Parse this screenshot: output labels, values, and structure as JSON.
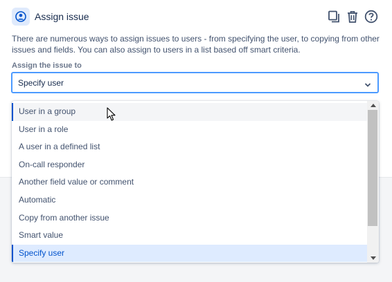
{
  "header": {
    "title": "Assign issue",
    "icons": [
      "user-avatar-icon",
      "copy-icon",
      "trash-icon",
      "help-icon"
    ]
  },
  "description": "There are numerous ways to assign issues to users - from specifying the user, to copying from other issues and fields. You can also assign to users in a list based off smart criteria.",
  "field": {
    "label": "Assign the issue to",
    "selected_value": "Specify user"
  },
  "dropdown": {
    "options": [
      "User in a group",
      "User in a role",
      "A user in a defined list",
      "On-call responder",
      "Another field value or comment",
      "Automatic",
      "Copy from another issue",
      "Smart value",
      "Specify user"
    ],
    "hovered_option": "User in a group",
    "selected_option": "Specify user"
  },
  "colors": {
    "focus_border": "#4c9aff",
    "selected_bg": "#deebff",
    "selected_text": "#0052cc",
    "hover_bg": "#f4f5f7"
  }
}
